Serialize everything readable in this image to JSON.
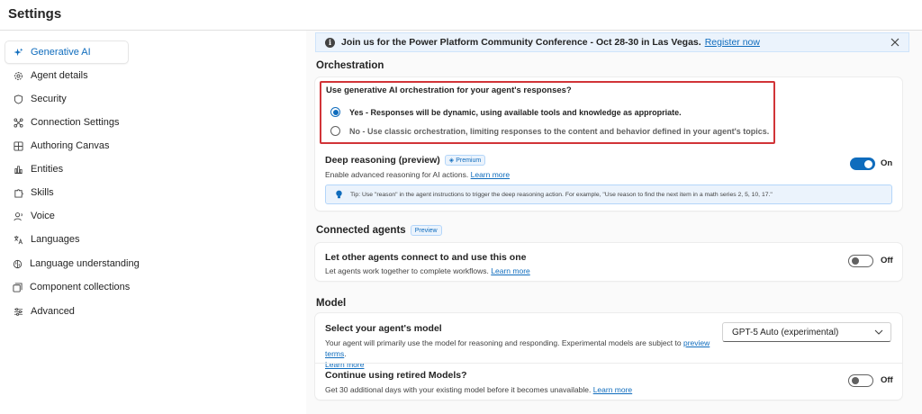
{
  "app": {
    "title": "Settings"
  },
  "sidebar": {
    "items": [
      {
        "label": "Generative AI",
        "icon": "sparkle-icon",
        "active": true
      },
      {
        "label": "Agent details",
        "icon": "gear-icon"
      },
      {
        "label": "Security",
        "icon": "shield-icon"
      },
      {
        "label": "Connection Settings",
        "icon": "connection-icon"
      },
      {
        "label": "Authoring Canvas",
        "icon": "canvas-icon"
      },
      {
        "label": "Entities",
        "icon": "entities-icon"
      },
      {
        "label": "Skills",
        "icon": "puzzle-icon"
      },
      {
        "label": "Voice",
        "icon": "voice-icon"
      },
      {
        "label": "Languages",
        "icon": "translate-icon"
      },
      {
        "label": "Language understanding",
        "icon": "brain-icon"
      },
      {
        "label": "Component collections",
        "icon": "collection-icon"
      },
      {
        "label": "Advanced",
        "icon": "sliders-icon"
      }
    ]
  },
  "banner": {
    "text": "Join us for the Power Platform Community Conference - Oct 28-30 in Las Vegas.",
    "link": "Register now"
  },
  "orchestration": {
    "heading": "Orchestration",
    "question": "Use generative AI orchestration for your agent's responses?",
    "options": [
      {
        "label": "Yes - Responses will be dynamic, using available tools and knowledge as appropriate.",
        "checked": true
      },
      {
        "label": "No - Use classic orchestration, limiting responses to the content and behavior defined in your agent's topics.",
        "checked": false
      }
    ],
    "deep_reasoning": {
      "title": "Deep reasoning (preview)",
      "badge": "Premium",
      "desc": "Enable advanced reasoning for AI actions.",
      "link": "Learn more",
      "toggle": "On",
      "tip": "Tip: Use \"reason\" in the agent instructions to trigger the deep reasoning action. For example, \"Use reason to find the next item in a math series 2, 5, 10, 17.\""
    }
  },
  "connected": {
    "heading": "Connected agents",
    "badge": "Preview",
    "title": "Let other agents connect to and use this one",
    "desc": "Let agents work together to complete workflows.",
    "link": "Learn more",
    "toggle": "Off"
  },
  "model": {
    "heading": "Model",
    "select_title": "Select your agent's model",
    "select_desc": "Your agent will primarily use the model for reasoning and responding. Experimental models are subject to",
    "select_desc_link": "preview terms",
    "select_desc_end": ".",
    "select_learn": "Learn more",
    "selected": "GPT-5 Auto (experimental)",
    "retired_title": "Continue using retired Models?",
    "retired_desc": "Get 30 additional days with your existing model before it becomes unavailable.",
    "retired_link": "Learn more",
    "retired_toggle": "Off"
  },
  "colors": {
    "accent": "#0f6cbd",
    "highlight_border": "#d13438",
    "info_bg": "#ebf3fc"
  }
}
